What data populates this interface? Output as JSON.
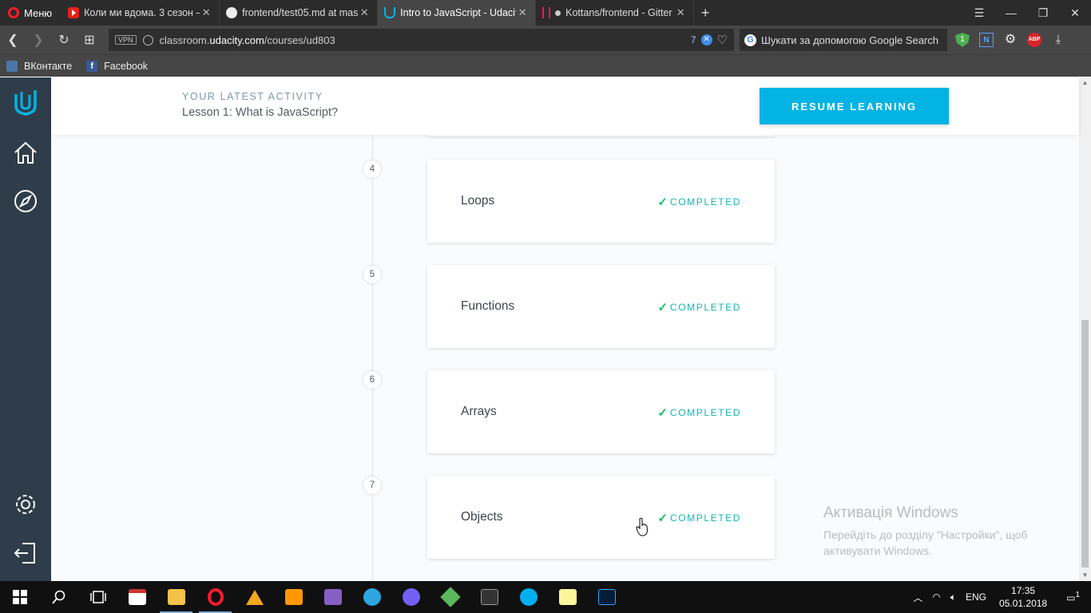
{
  "browser": {
    "menu_label": "Меню",
    "tabs": [
      {
        "title": "Коли ми вдома. 3 сезон –",
        "icon": "youtube-icon"
      },
      {
        "title": "frontend/test05.md at mas",
        "icon": "github-icon"
      },
      {
        "title": "Intro to JavaScript - Udacity",
        "icon": "udacity-icon"
      },
      {
        "title": "Kottans/frontend - Gitter",
        "icon": "gitter-icon"
      }
    ],
    "url_domain_prefix": "classroom.",
    "url_domain": "udacity.com",
    "url_path": "/courses/ud803",
    "vpn_label": "VPN",
    "tracker_count": "7",
    "search_placeholder": "Шукати за допомогою Google Search",
    "bookmarks": [
      {
        "label": "ВКонтакте",
        "icon": "vk-icon"
      },
      {
        "label": "Facebook",
        "icon": "facebook-icon"
      }
    ],
    "ext_badge": "1",
    "ext_abp": "ABP"
  },
  "header": {
    "activity_label": "YOUR LATEST ACTIVITY",
    "activity_lesson": "Lesson 1: What is JavaScript?",
    "resume_label": "RESUME LEARNING"
  },
  "lessons": [
    {
      "number": "4",
      "title": "Loops",
      "status": "COMPLETED"
    },
    {
      "number": "5",
      "title": "Functions",
      "status": "COMPLETED"
    },
    {
      "number": "6",
      "title": "Arrays",
      "status": "COMPLETED"
    },
    {
      "number": "7",
      "title": "Objects",
      "status": "COMPLETED"
    }
  ],
  "watermark": {
    "title": "Активація Windows",
    "line1": "Перейдіть до розділу \"Настройки\", щоб",
    "line2": "активувати Windows."
  },
  "taskbar": {
    "lang": "ENG",
    "time": "17:35",
    "date": "05.01.2018",
    "notification_count": "1"
  },
  "colors": {
    "accent": "#02b3e4",
    "sidebar": "#2e3d49",
    "completed": "#15c26b"
  }
}
